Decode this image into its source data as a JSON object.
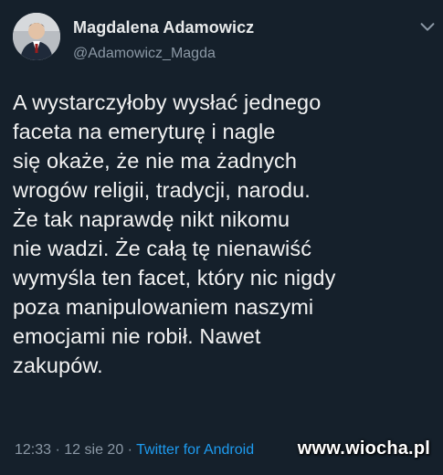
{
  "tweet": {
    "author_name": "Magdalena Adamowicz",
    "author_handle": "@Adamowicz_Magda",
    "text": "A wystarczyłoby wysłać jednego\nfaceta na emeryturę i nagle\nsię okaże, że nie ma żadnych\nwrogów religii, tradycji, narodu.\nŻe tak naprawdę nikt nikomu\nnie wadzi. Że całą tę nienawiść\nwymyśla ten facet, który nic nigdy\npoza manipulowaniem naszymi\nemocjami nie robił. Nawet\nzakupów.",
    "time": "12:33",
    "date": "12 sie 20",
    "separator": "·",
    "source": "Twitter for Android"
  },
  "icons": {
    "menu": "chevron-down-icon",
    "avatar": "avatar"
  },
  "watermark": "www.wiocha.pl",
  "colors": {
    "background": "#15202b",
    "text": "#f2f2f2",
    "muted": "#8b98a5",
    "accent": "#1d9bf0"
  }
}
